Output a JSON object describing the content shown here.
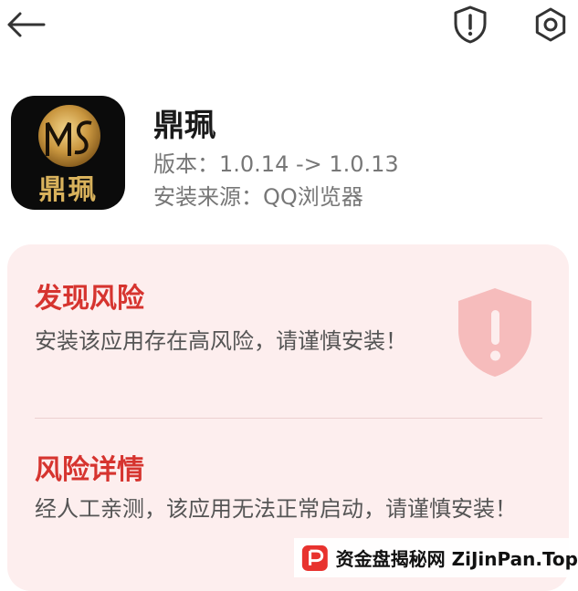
{
  "header": {
    "back_icon": "arrow-left-icon",
    "shield_icon": "shield-exclamation-icon",
    "settings_icon": "gear-icon"
  },
  "app": {
    "icon_text": "鼎珮",
    "name": "鼎珮",
    "version": "版本：1.0.14 -> 1.0.13",
    "source": "安装来源：QQ浏览器"
  },
  "risk": {
    "title": "发现风险",
    "text": "安装该应用存在高风险，请谨慎安装！",
    "detail_title": "风险详情",
    "detail_text": "经人工亲测，该应用无法正常启动，请谨慎安装！"
  },
  "watermark": {
    "text": "资金盘揭秘网 ZiJinPan.Top"
  },
  "colors": {
    "accent_red": "#d6342f",
    "card_bg": "#fdeeee",
    "meta_gray": "#777777"
  }
}
